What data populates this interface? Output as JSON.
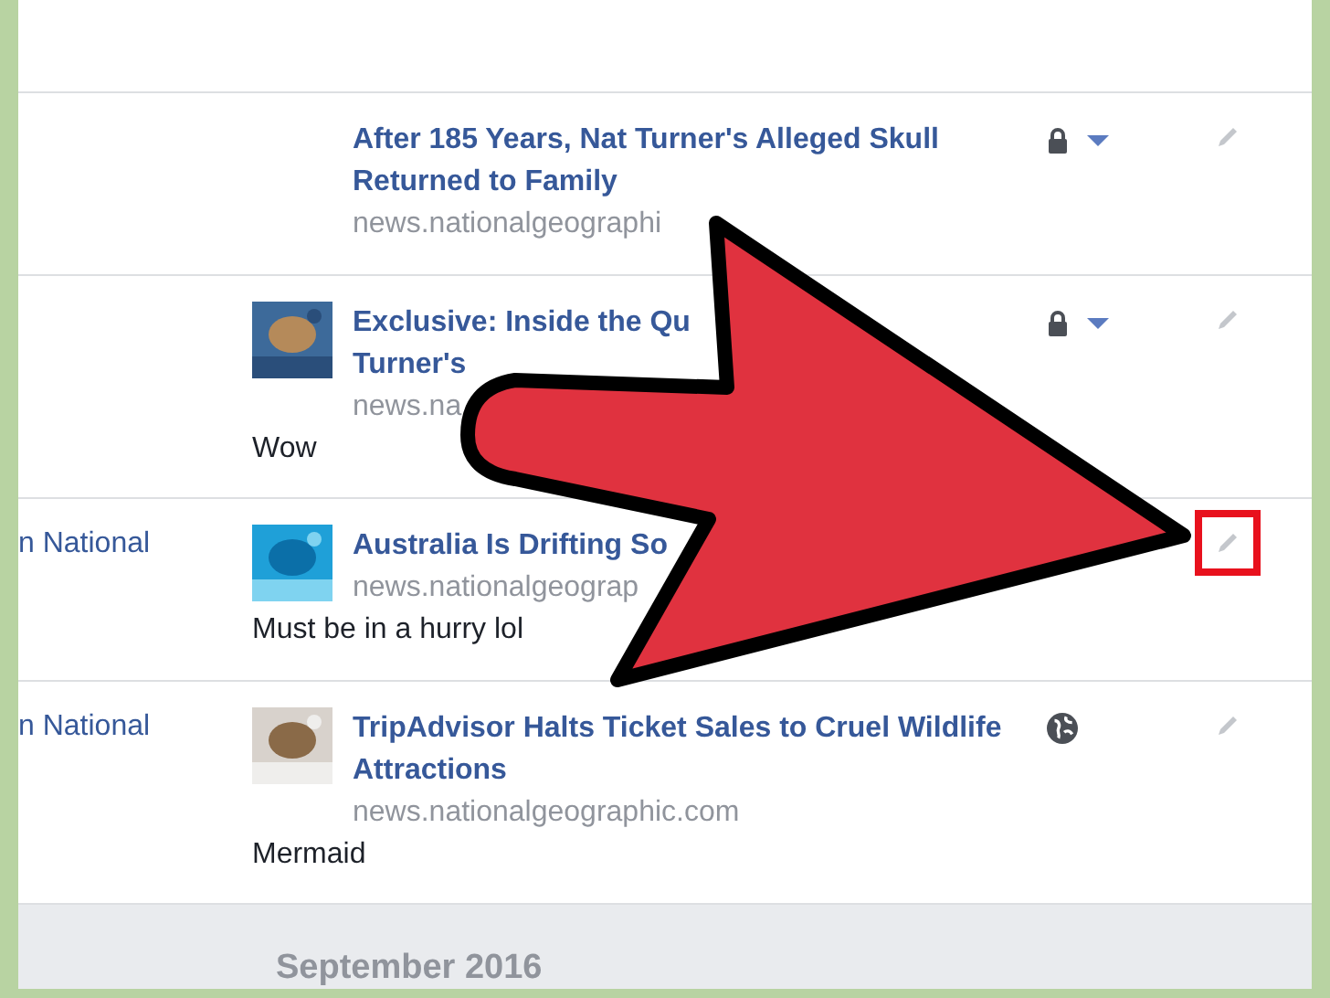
{
  "rows": [
    {
      "author": "",
      "thumbnail": false,
      "title_lines": [
        "After 185 Years, Nat Turner's Alleged Skull",
        "Returned to Family"
      ],
      "domain": "news.nationalgeographi",
      "comment": "",
      "locked": true,
      "public": false,
      "highlighted": false
    },
    {
      "author": "",
      "thumbnail": true,
      "title_lines": [
        "Exclusive: Inside the Qu",
        "Turner's"
      ],
      "domain": "news.na",
      "comment": "Wow",
      "locked": true,
      "public": false,
      "highlighted": false
    },
    {
      "author": "n National",
      "thumbnail": true,
      "title_lines": [
        "Australia Is Drifting So"
      ],
      "domain": "news.nationalgeograp",
      "comment": "Must be in a hurry lol",
      "locked": false,
      "public": false,
      "highlighted": true
    },
    {
      "author": "n National",
      "thumbnail": true,
      "title_lines": [
        "TripAdvisor Halts Ticket Sales to Cruel Wildlife",
        "Attractions"
      ],
      "domain": "news.nationalgeographic.com",
      "comment": "Mermaid",
      "locked": false,
      "public": true,
      "highlighted": false
    }
  ],
  "section": {
    "title": "September 2016"
  }
}
